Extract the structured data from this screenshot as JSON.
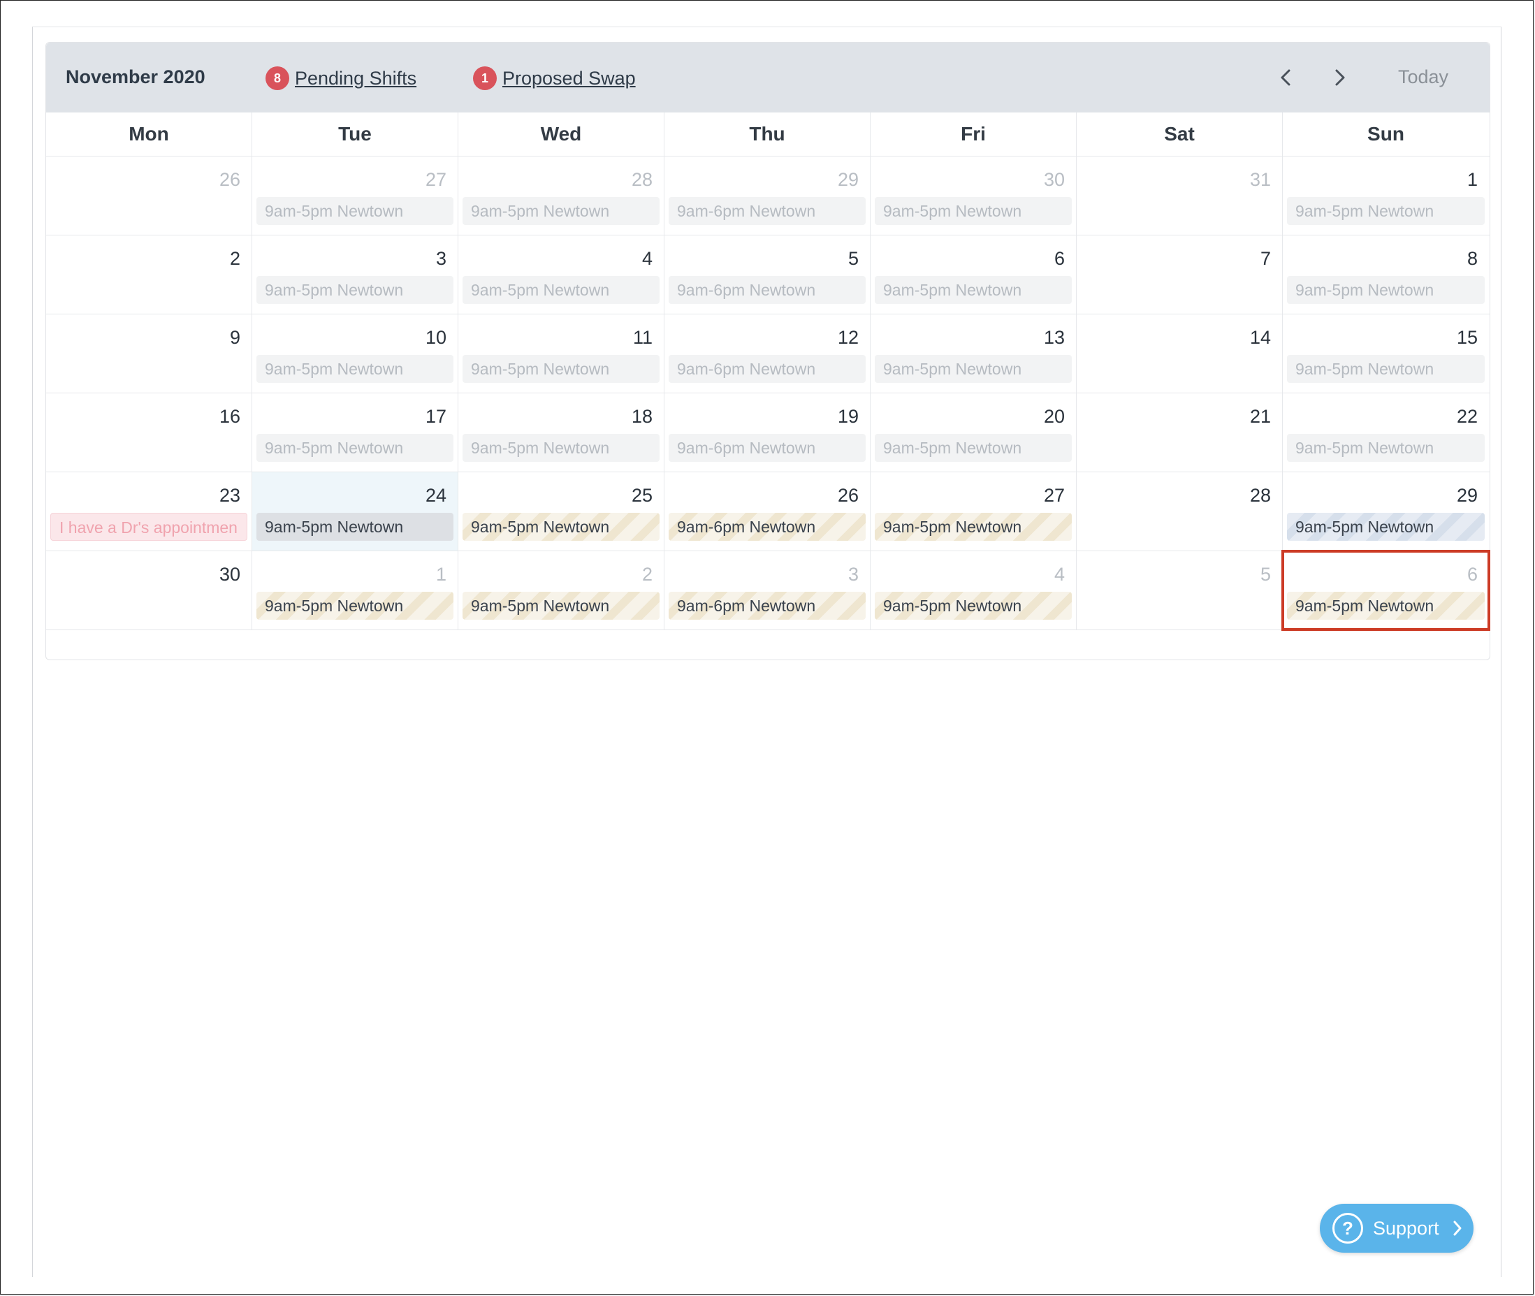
{
  "header": {
    "month_title": "November 2020",
    "pending_count": "8",
    "pending_label": "Pending Shifts",
    "swap_count": "1",
    "swap_label": "Proposed Swap",
    "today_label": "Today"
  },
  "weekdays": [
    "Mon",
    "Tue",
    "Wed",
    "Thu",
    "Fri",
    "Sat",
    "Sun"
  ],
  "weeks": [
    {
      "days": [
        {
          "num": "26",
          "muted": true,
          "shift": null
        },
        {
          "num": "27",
          "muted": true,
          "shift": {
            "text": "9am-5pm Newtown",
            "type": "past"
          }
        },
        {
          "num": "28",
          "muted": true,
          "shift": {
            "text": "9am-5pm Newtown",
            "type": "past"
          }
        },
        {
          "num": "29",
          "muted": true,
          "shift": {
            "text": "9am-6pm Newtown",
            "type": "past"
          }
        },
        {
          "num": "30",
          "muted": true,
          "shift": {
            "text": "9am-5pm Newtown",
            "type": "past"
          }
        },
        {
          "num": "31",
          "muted": true,
          "shift": null
        },
        {
          "num": "1",
          "muted": false,
          "shift": {
            "text": "9am-5pm Newtown",
            "type": "past"
          }
        }
      ]
    },
    {
      "days": [
        {
          "num": "2",
          "muted": false,
          "shift": null
        },
        {
          "num": "3",
          "muted": false,
          "shift": {
            "text": "9am-5pm Newtown",
            "type": "past"
          }
        },
        {
          "num": "4",
          "muted": false,
          "shift": {
            "text": "9am-5pm Newtown",
            "type": "past"
          }
        },
        {
          "num": "5",
          "muted": false,
          "shift": {
            "text": "9am-6pm Newtown",
            "type": "past"
          }
        },
        {
          "num": "6",
          "muted": false,
          "shift": {
            "text": "9am-5pm Newtown",
            "type": "past"
          }
        },
        {
          "num": "7",
          "muted": false,
          "shift": null
        },
        {
          "num": "8",
          "muted": false,
          "shift": {
            "text": "9am-5pm Newtown",
            "type": "past"
          }
        }
      ]
    },
    {
      "days": [
        {
          "num": "9",
          "muted": false,
          "shift": null
        },
        {
          "num": "10",
          "muted": false,
          "shift": {
            "text": "9am-5pm Newtown",
            "type": "past"
          }
        },
        {
          "num": "11",
          "muted": false,
          "shift": {
            "text": "9am-5pm Newtown",
            "type": "past"
          }
        },
        {
          "num": "12",
          "muted": false,
          "shift": {
            "text": "9am-6pm Newtown",
            "type": "past"
          }
        },
        {
          "num": "13",
          "muted": false,
          "shift": {
            "text": "9am-5pm Newtown",
            "type": "past"
          }
        },
        {
          "num": "14",
          "muted": false,
          "shift": null
        },
        {
          "num": "15",
          "muted": false,
          "shift": {
            "text": "9am-5pm Newtown",
            "type": "past"
          }
        }
      ]
    },
    {
      "days": [
        {
          "num": "16",
          "muted": false,
          "shift": null
        },
        {
          "num": "17",
          "muted": false,
          "shift": {
            "text": "9am-5pm Newtown",
            "type": "past"
          }
        },
        {
          "num": "18",
          "muted": false,
          "shift": {
            "text": "9am-5pm Newtown",
            "type": "past"
          }
        },
        {
          "num": "19",
          "muted": false,
          "shift": {
            "text": "9am-6pm Newtown",
            "type": "past"
          }
        },
        {
          "num": "20",
          "muted": false,
          "shift": {
            "text": "9am-5pm Newtown",
            "type": "past"
          }
        },
        {
          "num": "21",
          "muted": false,
          "shift": null
        },
        {
          "num": "22",
          "muted": false,
          "shift": {
            "text": "9am-5pm Newtown",
            "type": "past"
          }
        }
      ]
    },
    {
      "days": [
        {
          "num": "23",
          "muted": false,
          "shift": {
            "text": "I have a Dr's appointmen",
            "type": "note"
          }
        },
        {
          "num": "24",
          "muted": false,
          "today": true,
          "shift": {
            "text": "9am-5pm Newtown",
            "type": "current"
          }
        },
        {
          "num": "25",
          "muted": false,
          "shift": {
            "text": "9am-5pm Newtown",
            "type": "pending"
          }
        },
        {
          "num": "26",
          "muted": false,
          "shift": {
            "text": "9am-6pm Newtown",
            "type": "pending"
          }
        },
        {
          "num": "27",
          "muted": false,
          "shift": {
            "text": "9am-5pm Newtown",
            "type": "pending"
          }
        },
        {
          "num": "28",
          "muted": false,
          "shift": null
        },
        {
          "num": "29",
          "muted": false,
          "shift": {
            "text": "9am-5pm Newtown",
            "type": "swap"
          }
        }
      ]
    },
    {
      "days": [
        {
          "num": "30",
          "muted": false,
          "shift": null
        },
        {
          "num": "1",
          "muted": true,
          "shift": {
            "text": "9am-5pm Newtown",
            "type": "pending"
          }
        },
        {
          "num": "2",
          "muted": true,
          "shift": {
            "text": "9am-5pm Newtown",
            "type": "pending"
          }
        },
        {
          "num": "3",
          "muted": true,
          "shift": {
            "text": "9am-6pm Newtown",
            "type": "pending"
          }
        },
        {
          "num": "4",
          "muted": true,
          "shift": {
            "text": "9am-5pm Newtown",
            "type": "pending"
          }
        },
        {
          "num": "5",
          "muted": true,
          "shift": null
        },
        {
          "num": "6",
          "muted": true,
          "selected": true,
          "shift": {
            "text": "9am-5pm Newtown",
            "type": "pending"
          }
        }
      ]
    }
  ],
  "support": {
    "label": "Support",
    "icon": "question-circle-icon"
  },
  "colors": {
    "badge": "#d9535b",
    "support": "#5ab4ea",
    "selection": "#cc3b26",
    "header_bg": "#dfe3e8"
  }
}
